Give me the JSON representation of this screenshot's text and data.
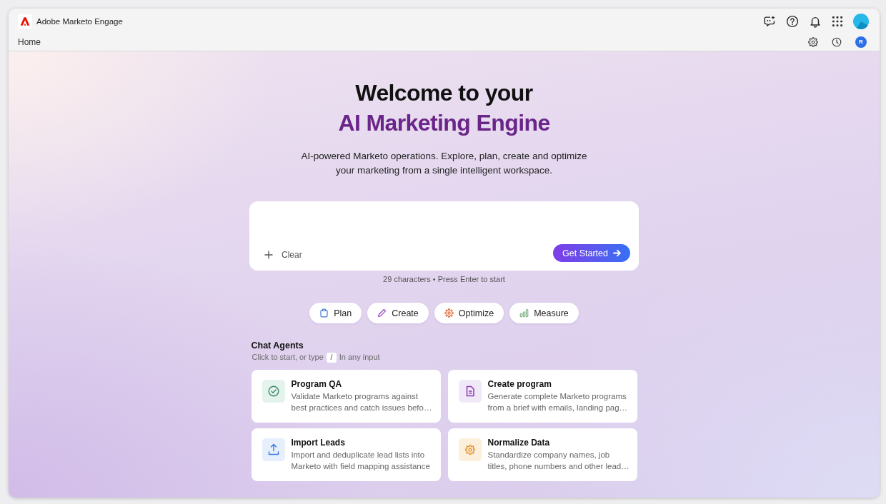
{
  "app": {
    "name": "Adobe Marketo Engage"
  },
  "breadcrumb": {
    "label": "Home"
  },
  "user": {
    "initial": "R"
  },
  "hero": {
    "title": "Welcome to your",
    "highlight": "AI Marketing Engine",
    "subtitle": "AI-powered Marketo operations. Explore, plan, create and optimize your marketing from a single intelligent workspace."
  },
  "prompt": {
    "clear_label": "Clear",
    "submit_label": "Get Started",
    "hint": "29 characters • Press Enter to start"
  },
  "quick_actions": [
    {
      "kind": "plan",
      "label": "Plan"
    },
    {
      "kind": "create",
      "label": "Create"
    },
    {
      "kind": "optimize",
      "label": "Optimize"
    },
    {
      "kind": "measure",
      "label": "Measure"
    }
  ],
  "chat_agents": {
    "title": "Chat Agents",
    "hint": "Click to start, or type",
    "key": "/",
    "hint_end": "In any input",
    "agents": [
      {
        "kind": "check",
        "name": "Program QA",
        "description": "Validate Marketo programs against best practices and catch issues befo…"
      },
      {
        "kind": "document",
        "name": "Create program",
        "description": "Generate complete Marketo programs from a brief with emails, landing pag…"
      },
      {
        "kind": "upload",
        "name": "Import Leads",
        "description": "Import and deduplicate lead lists into Marketo with field mapping assistance"
      },
      {
        "kind": "gear",
        "name": "Normalize Data",
        "description": "Standardize company names, job titles, phone numbers and other lead…"
      }
    ]
  }
}
